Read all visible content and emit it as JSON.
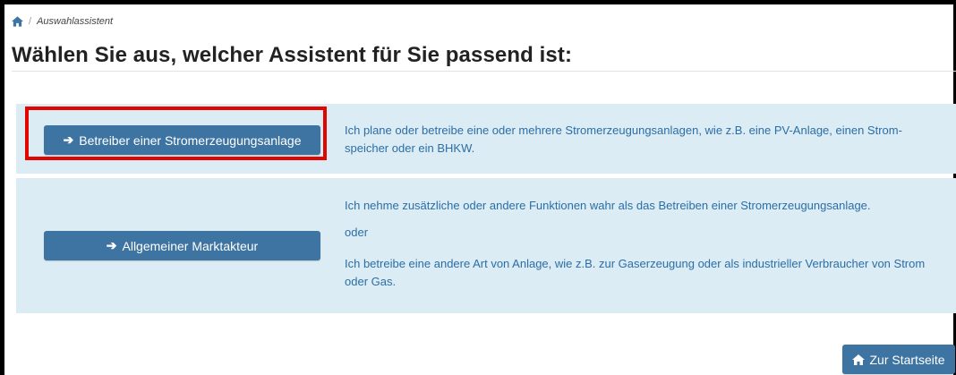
{
  "breadcrumb": {
    "current": "Auswahlassistent",
    "separator": "/",
    "home_icon": "home-icon"
  },
  "page": {
    "title": "Wählen Sie aus, welcher Assistent für Sie passend ist:"
  },
  "options": [
    {
      "button_label": "Betreiber einer Stromerzeugungsanlage",
      "arrow": "➔",
      "description": "Ich plane oder betreibe eine oder mehrere Stromerzeugungsanlagen, wie z.B. eine PV-Anlage, einen Strom-speicher oder ein BHKW."
    },
    {
      "button_label": "Allgemeiner Marktakteur",
      "arrow": "➔",
      "description_a": "Ich nehme zusätzliche oder andere Funktionen wahr als das Betreiben einer Stromerzeugungsanlage.",
      "description_or": "oder",
      "description_b": "Ich betreibe eine andere Art von Anlage, wie z.B. zur Gaserzeugung oder als industrieller Verbraucher von Strom oder Gas."
    }
  ],
  "footer": {
    "home_button_label": "Zur Startseite",
    "home_icon": "home-icon"
  },
  "colors": {
    "accent": "#3d74a2",
    "panel": "#dcecf4",
    "highlight": "#e10600",
    "desc_text": "#2b6ea6"
  }
}
